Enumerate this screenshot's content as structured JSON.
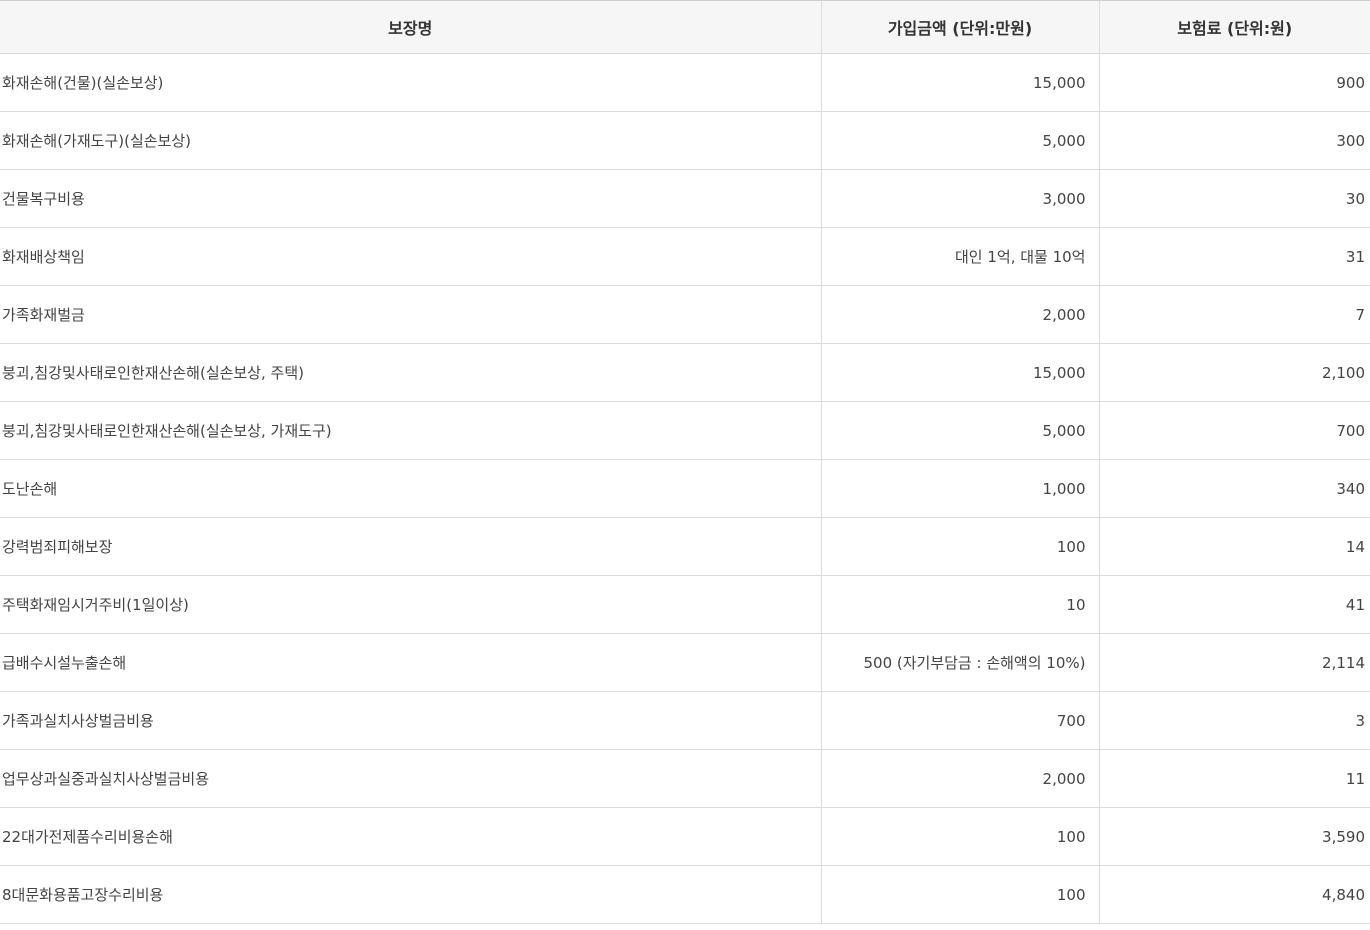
{
  "table": {
    "headers": [
      "보장명",
      "가입금액 (단위:만원)",
      "보험료 (단위:원)"
    ],
    "rows": [
      {
        "name": "화재손해(건물)(실손보상)",
        "amount": "15,000",
        "premium": "900"
      },
      {
        "name": "화재손해(가재도구)(실손보상)",
        "amount": "5,000",
        "premium": "300"
      },
      {
        "name": "건물복구비용",
        "amount": "3,000",
        "premium": "30"
      },
      {
        "name": "화재배상책임",
        "amount": "대인 1억, 대물 10억",
        "premium": "31"
      },
      {
        "name": "가족화재벌금",
        "amount": "2,000",
        "premium": "7"
      },
      {
        "name": "붕괴,침강및사태로인한재산손해(실손보상, 주택)",
        "amount": "15,000",
        "premium": "2,100"
      },
      {
        "name": "붕괴,침강및사태로인한재산손해(실손보상, 가재도구)",
        "amount": "5,000",
        "premium": "700"
      },
      {
        "name": "도난손해",
        "amount": "1,000",
        "premium": "340"
      },
      {
        "name": "강력범죄피해보장",
        "amount": "100",
        "premium": "14"
      },
      {
        "name": "주택화재임시거주비(1일이상)",
        "amount": "10",
        "premium": "41"
      },
      {
        "name": "급배수시설누출손해",
        "amount": "500 (자기부담금 : 손해액의 10%)",
        "premium": "2,114"
      },
      {
        "name": "가족과실치사상벌금비용",
        "amount": "700",
        "premium": "3"
      },
      {
        "name": "업무상과실중과실치사상벌금비용",
        "amount": "2,000",
        "premium": "11"
      },
      {
        "name": "22대가전제품수리비용손해",
        "amount": "100",
        "premium": "3,590"
      },
      {
        "name": "8대문화용품고장수리비용",
        "amount": "100",
        "premium": "4,840"
      }
    ]
  }
}
